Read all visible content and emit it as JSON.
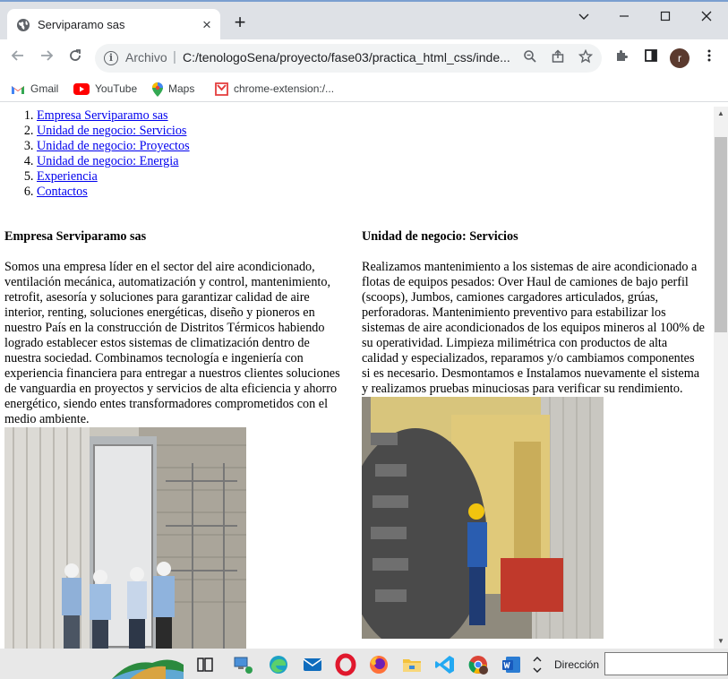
{
  "browser": {
    "tab_title": "Serviparamo sas",
    "url_scheme": "Archivo",
    "url": "C:/tenologoSena/proyecto/fase03/practica_html_css/inde...",
    "profile_initial": "r"
  },
  "bookmarks": [
    {
      "label": "Gmail",
      "icon": "gmail-icon"
    },
    {
      "label": "YouTube",
      "icon": "youtube-icon"
    },
    {
      "label": "Maps",
      "icon": "maps-icon"
    },
    {
      "label": "chrome-extension:/...",
      "icon": "extension-bookmark-icon"
    }
  ],
  "page": {
    "nav": [
      "Empresa Serviparamo sas",
      "Unidad de negocio: Servicios",
      "Unidad de negocio: Proyectos",
      "Unidad de negocio: Energia",
      "Experiencia",
      "Contactos"
    ],
    "section1": {
      "heading": "Empresa Serviparamo sas",
      "body": "Somos una empresa líder en el sector del aire acondicionado, ventilación mecánica, automatización y control, mantenimiento, retrofit, asesoría y soluciones para garantizar calidad de aire interior, renting, soluciones energéticas, diseño y pioneros en nuestro País en la construcción de Distritos Térmicos habiendo logrado establecer estos sistemas de climatización dentro de nuestra sociedad. Combinamos tecnología e ingeniería con experiencia financiera para entregar a nuestros clientes soluciones de vanguardia en proyectos y servicios de alta eficiencia y ahorro energético, siendo entes transformadores comprometidos con el medio ambiente."
    },
    "section2": {
      "heading": "Unidad de negocio: Servicios",
      "body": "Realizamos mantenimiento a los sistemas de aire acondicionado a flotas de equipos pesados: Over Haul de camiones de bajo perfil (scoops), Jumbos, camiones cargadores articulados, grúas, perforadoras. Mantenimiento preventivo para estabilizar los sistemas de aire acondicionados de los equipos mineros al 100% de su operatividad. Limpieza milimétrica con productos de alta calidad y especializados, reparamos y/o cambiamos componentes si es necesario. Desmontamos e Instalamos nuevamente el sistema y realizamos pruebas minuciosas para verificar su rendimiento."
    }
  },
  "taskbar": {
    "address_label": "Dirección"
  },
  "colors": {
    "link": "#0000ee",
    "tabstrip": "#dee1e6",
    "omnibox": "#f1f3f4",
    "taskbar": "#e8e8e8"
  }
}
